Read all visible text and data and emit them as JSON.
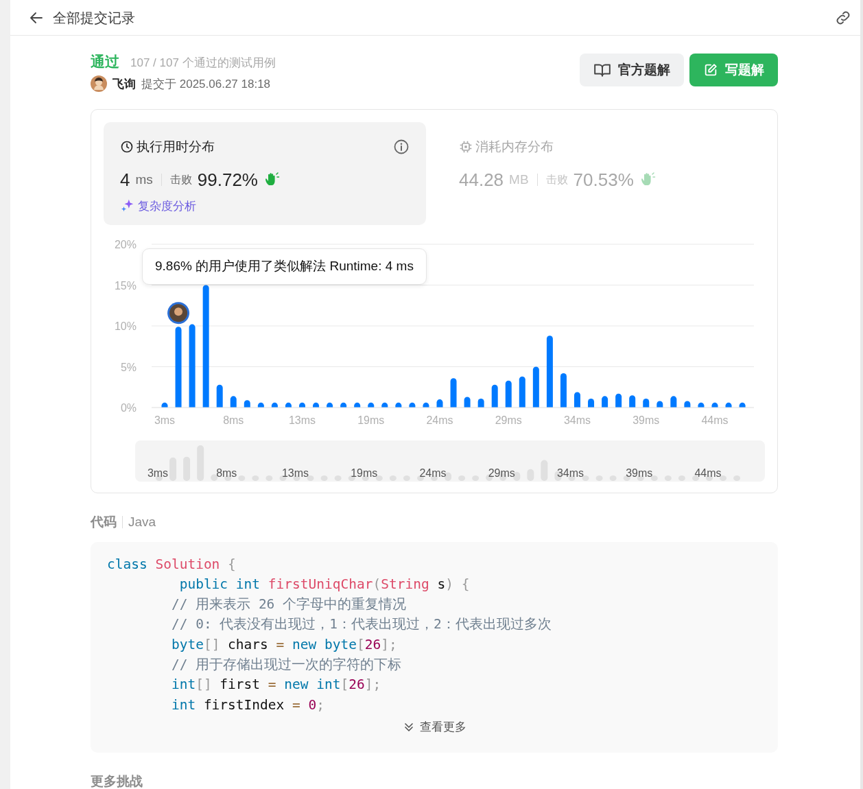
{
  "header": {
    "title": "全部提交记录"
  },
  "submission": {
    "status": "通过",
    "tests": "107 / 107 个通过的测试用例",
    "user": "飞询",
    "submitted": "提交于 2025.06.27 18:18"
  },
  "buttons": [
    {
      "label": "官方题解",
      "kind": "secondary"
    },
    {
      "label": "写题解",
      "kind": "primary"
    }
  ],
  "stats": [
    {
      "title": "执行用时分布",
      "selected": true,
      "value": "4",
      "unit": "ms",
      "beat_label": "击败",
      "beat": "99.72%",
      "analysis_link": "复杂度分析"
    },
    {
      "title": "消耗内存分布",
      "selected": false,
      "value": "44.28",
      "unit": "MB",
      "beat_label": "击败",
      "beat": "70.53%"
    }
  ],
  "chart_data": {
    "type": "bar",
    "categories": [
      "3ms",
      null,
      null,
      null,
      null,
      "8ms",
      null,
      null,
      null,
      null,
      "13ms",
      null,
      null,
      null,
      null,
      "19ms",
      null,
      null,
      null,
      null,
      "24ms",
      null,
      null,
      null,
      null,
      "29ms",
      null,
      null,
      null,
      null,
      "34ms",
      null,
      null,
      null,
      null,
      "39ms",
      null,
      null,
      null,
      null,
      "44ms",
      null,
      null
    ],
    "series": [
      {
        "color": "#007aff",
        "values": [
          0.6,
          9.9,
          10.2,
          15.0,
          2.8,
          1.4,
          0.9,
          0.6,
          0.6,
          0.6,
          0.6,
          0.6,
          0.6,
          0.6,
          0.6,
          0.6,
          0.6,
          0.6,
          0.6,
          0.6,
          1.0,
          3.6,
          1.3,
          1.1,
          2.8,
          3.3,
          3.8,
          5.0,
          8.8,
          4.2,
          1.9,
          1.1,
          1.4,
          1.7,
          1.5,
          1.1,
          0.8,
          1.4,
          0.8,
          0.6,
          0.6,
          0.6,
          0.6
        ]
      }
    ],
    "ylim": [
      0,
      20
    ],
    "yticks": [
      {
        "value": 0,
        "label": "0%"
      },
      {
        "value": 5,
        "label": "5%"
      },
      {
        "value": 10,
        "label": "10%"
      },
      {
        "value": 15,
        "label": "15%"
      },
      {
        "value": 20,
        "label": "20%"
      }
    ],
    "grid": true
  },
  "tooltip": {
    "text": "9.86% 的用户使用了类似解法 Runtime: 4 ms"
  },
  "navigator": {
    "labels": [
      "3ms",
      "8ms",
      "13ms",
      "19ms",
      "24ms",
      "29ms",
      "34ms",
      "39ms",
      "44ms"
    ]
  },
  "code": {
    "title": "代码",
    "language": "Java",
    "show_more": "查看更多",
    "lines": [
      [
        {
          "kind": "keyword",
          "t": "class"
        },
        {
          "kind": "class",
          "t": " Solution"
        },
        {
          "kind": "punct",
          "t": " {"
        }
      ],
      [
        {
          "kind": "keyword",
          "t": "         public"
        },
        {
          "kind": "keyword",
          "t": " int"
        },
        {
          "kind": "function",
          "t": " firstUniqChar"
        },
        {
          "kind": "punct",
          "t": "("
        },
        {
          "kind": "class",
          "t": "String"
        },
        {
          "kind": "plain",
          "t": " s"
        },
        {
          "kind": "punct",
          "t": ")"
        },
        {
          "kind": "punct",
          "t": " {"
        }
      ],
      [
        {
          "kind": "comment",
          "t": "        // 用来表示 26 个字母中的重复情况"
        }
      ],
      [
        {
          "kind": "comment",
          "t": "        // 0: 代表没有出现过，1：代表出现过，2：代表出现过多次"
        }
      ],
      [
        {
          "kind": "keyword",
          "t": "        byte"
        },
        {
          "kind": "punct",
          "t": "[]"
        },
        {
          "kind": "plain",
          "t": " chars "
        },
        {
          "kind": "operator",
          "t": "="
        },
        {
          "kind": "keyword",
          "t": " new"
        },
        {
          "kind": "keyword",
          "t": " byte"
        },
        {
          "kind": "punct",
          "t": "["
        },
        {
          "kind": "number",
          "t": "26"
        },
        {
          "kind": "punct",
          "t": "];"
        }
      ],
      [
        {
          "kind": "comment",
          "t": "        // 用于存储出现过一次的字符的下标"
        }
      ],
      [
        {
          "kind": "keyword",
          "t": "        int"
        },
        {
          "kind": "punct",
          "t": "[]"
        },
        {
          "kind": "plain",
          "t": " first "
        },
        {
          "kind": "operator",
          "t": "="
        },
        {
          "kind": "keyword",
          "t": " new"
        },
        {
          "kind": "keyword",
          "t": " int"
        },
        {
          "kind": "punct",
          "t": "["
        },
        {
          "kind": "number",
          "t": "26"
        },
        {
          "kind": "punct",
          "t": "];"
        }
      ],
      [
        {
          "kind": "keyword",
          "t": "        int"
        },
        {
          "kind": "plain",
          "t": " firstIndex "
        },
        {
          "kind": "operator",
          "t": "="
        },
        {
          "kind": "number",
          "t": " 0"
        },
        {
          "kind": "punct",
          "t": ";"
        }
      ]
    ]
  },
  "more": {
    "title": "更多挑战"
  }
}
